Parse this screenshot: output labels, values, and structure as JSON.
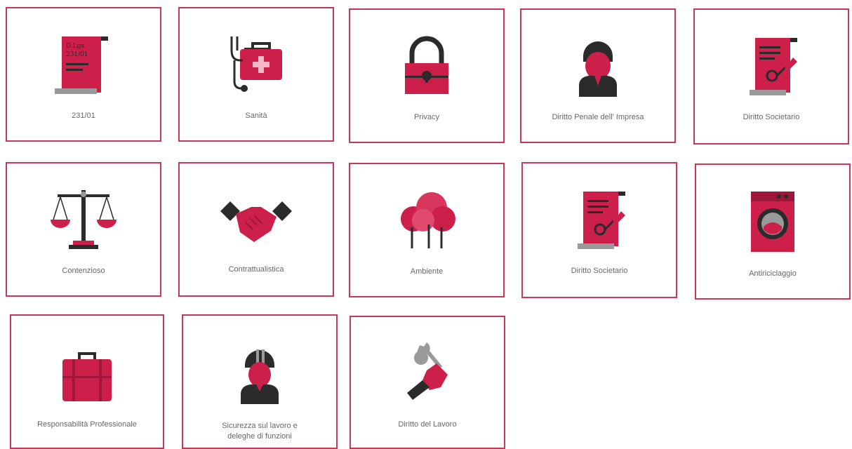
{
  "colors": {
    "accent": "#cc1f4a",
    "dark": "#2b2b2b",
    "gray": "#9a9a9a",
    "border": "#c8385a"
  },
  "tiles": [
    {
      "label": "231/01",
      "icon": "law-scroll-icon",
      "scroll_text_1": "D.Lgs.",
      "scroll_text_2": "231/01"
    },
    {
      "label": "Sanità",
      "icon": "medical-bag-stethoscope-icon"
    },
    {
      "label": "Privacy",
      "icon": "padlock-icon"
    },
    {
      "label": "Diritto Penale dell' Impresa",
      "icon": "businessman-icon"
    },
    {
      "label": "Diritto Societario",
      "icon": "contract-seal-icon"
    },
    {
      "label": "Contenzioso",
      "icon": "scales-of-justice-icon"
    },
    {
      "label": "Contrattualistica",
      "icon": "handshake-icon"
    },
    {
      "label": "Ambiente",
      "icon": "trees-icon"
    },
    {
      "label": "Diritto Societario",
      "icon": "contract-seal-icon"
    },
    {
      "label": "Antiriciclaggio",
      "icon": "washing-machine-icon"
    },
    {
      "label": "Responsabilità Professionale",
      "icon": "briefcase-icon"
    },
    {
      "label": "Sicurezza sul lavoro e deleghe di funzioni",
      "icon": "worker-helmet-icon"
    },
    {
      "label": "Diritto del Lavoro",
      "icon": "wrench-hand-icon"
    }
  ]
}
